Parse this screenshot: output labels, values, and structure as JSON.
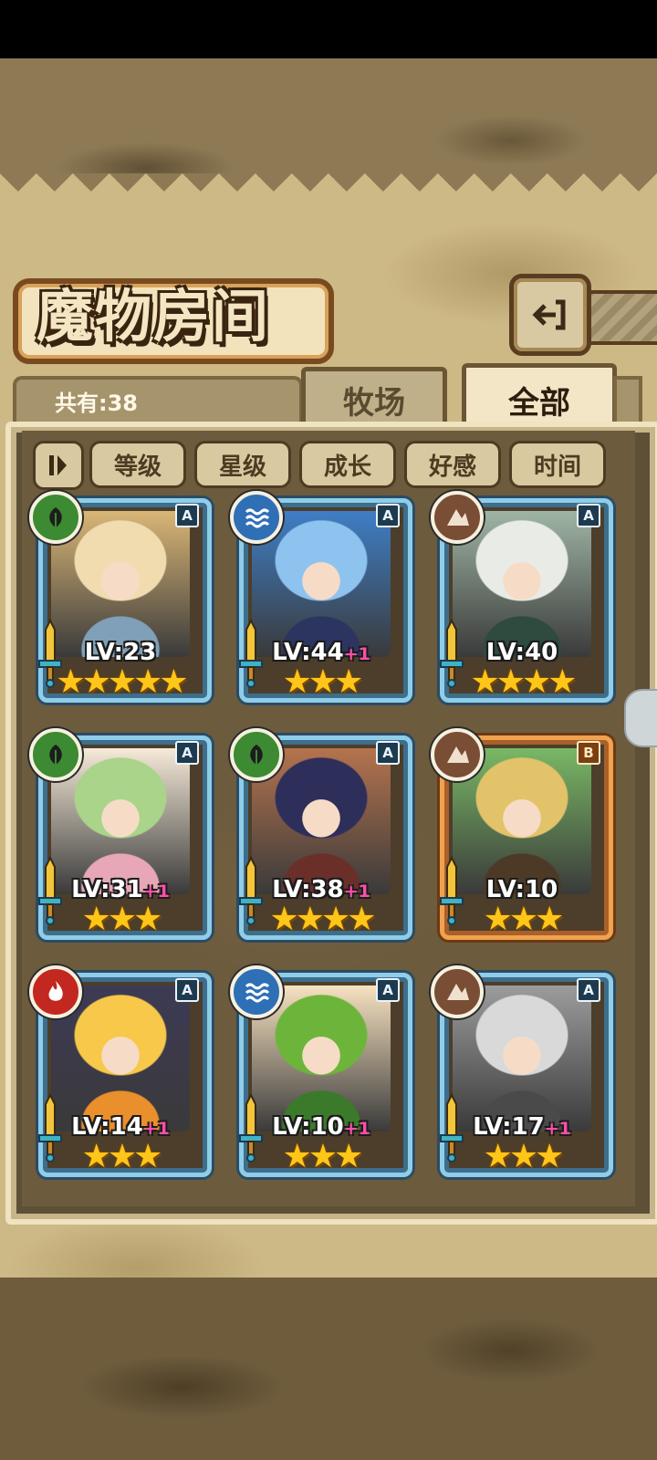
{
  "header": {
    "title": "魔物房间",
    "count_label": "共有:38"
  },
  "tabs": [
    {
      "label": "牧场",
      "active": false
    },
    {
      "label": "全部",
      "active": true
    }
  ],
  "sort": {
    "options": [
      "等级",
      "星级",
      "成长",
      "好感",
      "时间"
    ]
  },
  "monsters": [
    {
      "element": "leaf-icon",
      "rank": "A",
      "level": "LV:23",
      "bonus": "",
      "stars": "★★★★★",
      "star_count": 5,
      "palette": [
        "#f1dcb0",
        "#d9b676",
        "#7fa0b8"
      ]
    },
    {
      "element": "water-icon",
      "rank": "A",
      "level": "LV:44",
      "bonus": "+1",
      "stars": "★★★",
      "star_count": 3,
      "palette": [
        "#8fc3ef",
        "#3f7ec6",
        "#2c3560"
      ]
    },
    {
      "element": "earth-icon",
      "rank": "A",
      "level": "LV:40",
      "bonus": "",
      "stars": "★★★★",
      "star_count": 4,
      "palette": [
        "#e9ece6",
        "#9fb5a4",
        "#2f4a3e"
      ]
    },
    {
      "element": "leaf-icon",
      "rank": "A",
      "level": "LV:31",
      "bonus": "+1",
      "stars": "★★★",
      "star_count": 3,
      "palette": [
        "#a9d48a",
        "#f6ead8",
        "#e7a7b7"
      ]
    },
    {
      "element": "leaf-icon",
      "rank": "A",
      "level": "LV:38",
      "bonus": "+1",
      "stars": "★★★★",
      "star_count": 4,
      "palette": [
        "#2e2e5a",
        "#b5734e",
        "#6b2f2a"
      ]
    },
    {
      "element": "earth-icon",
      "rank": "B",
      "level": "LV:10",
      "bonus": "",
      "stars": "★★★",
      "star_count": 3,
      "palette": [
        "#e3c36a",
        "#79b865",
        "#4d3a26"
      ]
    },
    {
      "element": "fire-icon",
      "rank": "A",
      "level": "LV:14",
      "bonus": "+1",
      "stars": "★★★",
      "star_count": 3,
      "palette": [
        "#f7c84a",
        "#3d3a55",
        "#e98f2c"
      ]
    },
    {
      "element": "water-icon",
      "rank": "A",
      "level": "LV:10",
      "bonus": "+1",
      "stars": "★★★",
      "star_count": 3,
      "palette": [
        "#6cb53a",
        "#f7e2c0",
        "#3b7a2a"
      ]
    },
    {
      "element": "earth-icon",
      "rank": "A",
      "level": "LV:17",
      "bonus": "+1",
      "stars": "★★★",
      "star_count": 3,
      "palette": [
        "#d9d9d9",
        "#9c9c9c",
        "#4a4a4a"
      ]
    }
  ]
}
